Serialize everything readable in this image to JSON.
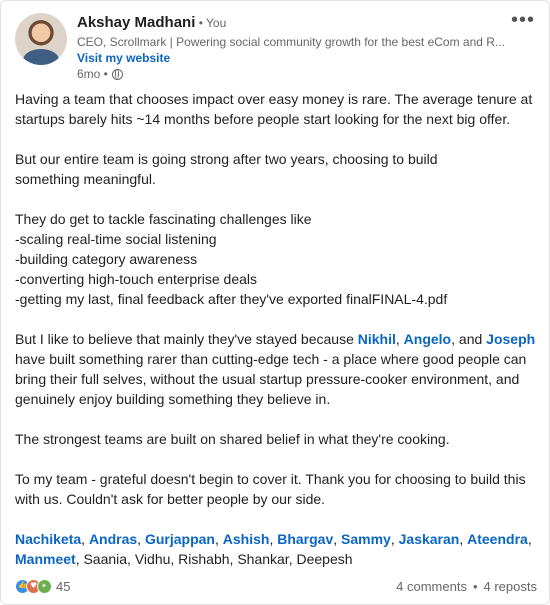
{
  "post": {
    "author": "Akshay Madhani",
    "you_badge": " • You",
    "headline": "CEO, Scrollmark | Powering social community growth for the best eCom and R...",
    "website_link": "Visit my website",
    "age": "6mo •",
    "menu": "•••",
    "paragraph1": "Having a team that chooses impact over easy money is rare. The average tenure at startups barely hits ~14 months before people start looking for the next big offer.",
    "paragraph2_line1": "But our entire team is going strong after two years, choosing to build",
    "paragraph2_line2": "something meaningful.",
    "paragraph3_lines": [
      "They do get to tackle fascinating challenges like",
      "-scaling real-time social listening",
      "-building category awareness",
      "-converting high-touch enterprise deals",
      "-getting my last, final feedback after they've exported finalFINAL-4.pdf"
    ],
    "paragraph4_prefix": "But I like to believe that mainly they've stayed because ",
    "mention_nikhil": "Nikhil",
    "comma1": ", ",
    "mention_angelo": "Angelo",
    "and_text": ", and ",
    "mention_joseph": "Joseph",
    "paragraph4_suffix": " have built something rarer than cutting-edge tech - a place where good people can bring their full selves, without the usual startup pressure-cooker environment, and genuinely enjoy building something they believe in.",
    "paragraph5": "The strongest teams are built on shared belief in what they're cooking.",
    "paragraph6": "To my team - grateful doesn't begin to cover it. Thank you for choosing to build this with us. Couldn't ask for better people by our side.",
    "tagged_mentions": [
      "Nachiketa",
      "Andras",
      "Gurjappan",
      "Ashish",
      "Bhargav",
      "Sammy",
      "Jaskaran",
      "Ateendra",
      "Manmeet"
    ],
    "tagged_plain": "Saania, Vidhu, Rishabh, Shankar, Deepesh"
  },
  "footer": {
    "reaction_icons": [
      "like-icon",
      "heart-icon",
      "clap-icon"
    ],
    "reaction_count": "45",
    "comments": "4 comments",
    "separator": "•",
    "reposts": "4 reposts"
  },
  "colors": {
    "link": "#0a66c2",
    "muted": "#666666",
    "like": "#378fe9",
    "love": "#df704d",
    "celebrate": "#6dae4f"
  }
}
